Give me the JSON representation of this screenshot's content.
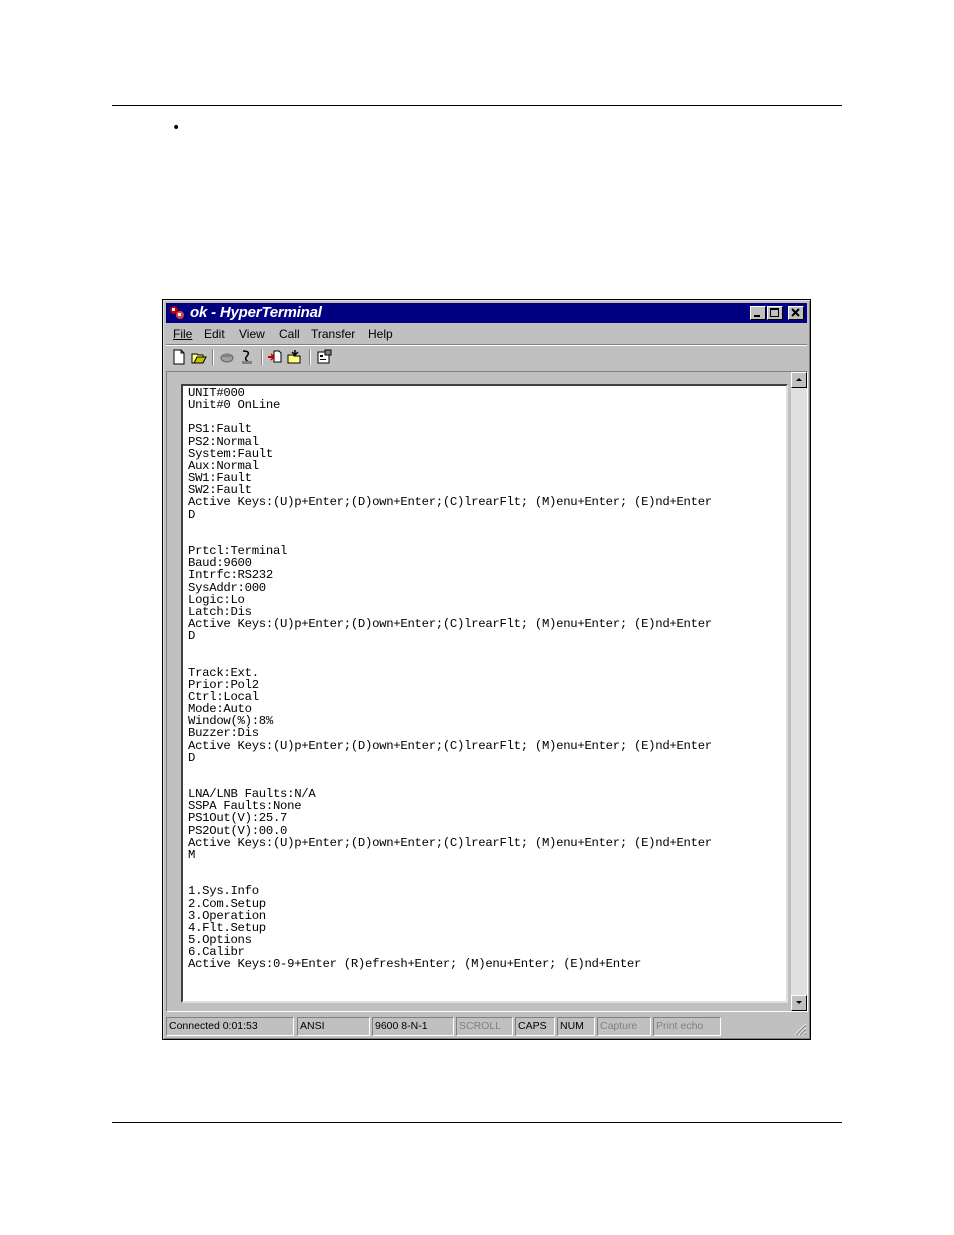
{
  "window": {
    "title": "ok - HyperTerminal"
  },
  "menu": [
    "File",
    "Edit",
    "View",
    "Call",
    "Transfer",
    "Help"
  ],
  "toolbar": {
    "icons": [
      "new-icon",
      "open-icon",
      "connect-icon",
      "disconnect-icon",
      "send-icon",
      "receive-icon",
      "properties-icon"
    ]
  },
  "terminal": {
    "text": "UNIT#000\nUnit#0 OnLine\n\nPS1:Fault\nPS2:Normal\nSystem:Fault\nAux:Normal\nSW1:Fault\nSW2:Fault\nActive Keys:(U)p+Enter;(D)own+Enter;(C)lrearFlt; (M)enu+Enter; (E)nd+Enter\nD\n\n\nPrtcl:Terminal\nBaud:9600\nIntrfc:RS232\nSysAddr:000\nLogic:Lo\nLatch:Dis\nActive Keys:(U)p+Enter;(D)own+Enter;(C)lrearFlt; (M)enu+Enter; (E)nd+Enter\nD\n\n\nTrack:Ext.\nPrior:Pol2\nCtrl:Local\nMode:Auto\nWindow(%):8%\nBuzzer:Dis\nActive Keys:(U)p+Enter;(D)own+Enter;(C)lrearFlt; (M)enu+Enter; (E)nd+Enter\nD\n\n\nLNA/LNB Faults:N/A\nSSPA Faults:None\nPS1Out(V):25.7\nPS2Out(V):00.0\nActive Keys:(U)p+Enter;(D)own+Enter;(C)lrearFlt; (M)enu+Enter; (E)nd+Enter\nM\n\n\n1.Sys.Info\n2.Com.Setup\n3.Operation\n4.Flt.Setup\n5.Options\n6.Calibr\nActive Keys:0-9+Enter (R)efresh+Enter; (M)enu+Enter; (E)nd+Enter"
  },
  "status": {
    "connected": "Connected 0:01:53",
    "emulation": "ANSI",
    "port": "9600 8-N-1",
    "scroll": "SCROLL",
    "caps": "CAPS",
    "num": "NUM",
    "capture": "Capture",
    "print_echo": "Print echo"
  },
  "colors": {
    "titlebar": "#000080",
    "chrome": "#c0c0c0"
  }
}
